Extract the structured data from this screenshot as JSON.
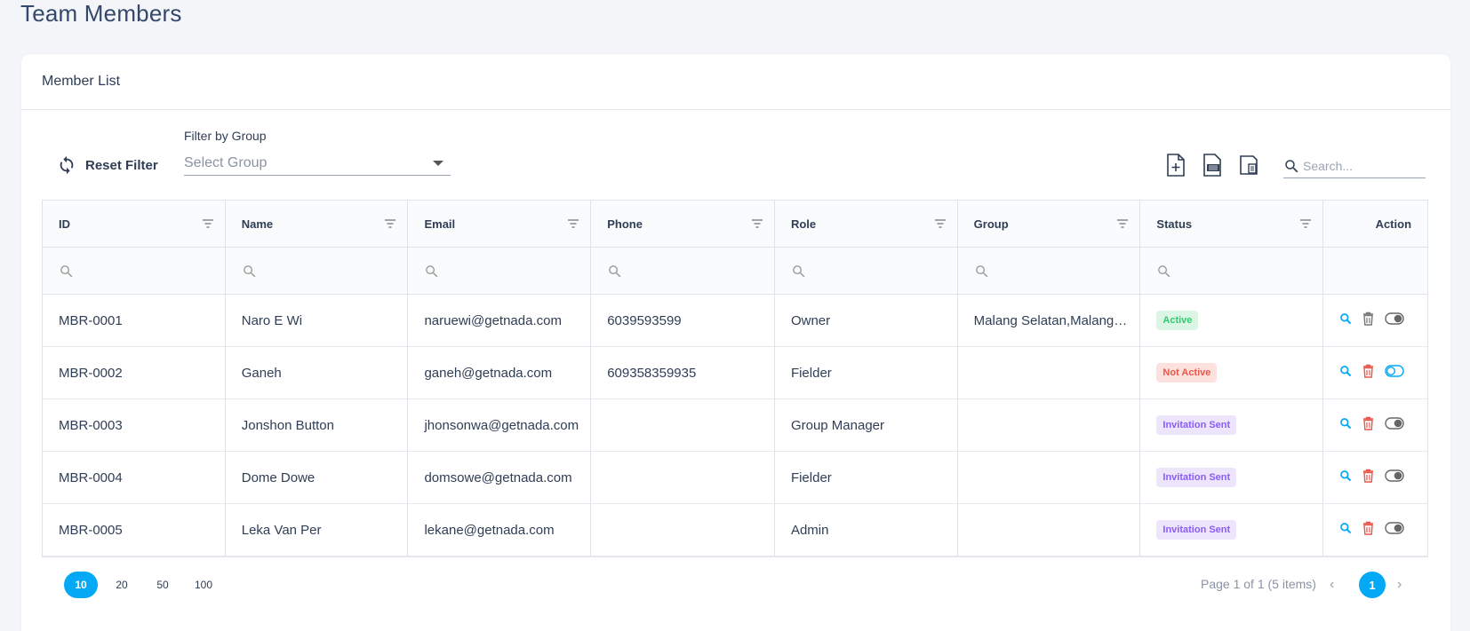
{
  "page": {
    "title": "Team Members"
  },
  "card": {
    "title": "Member List"
  },
  "toolbar": {
    "reset_label": "Reset Filter",
    "filter_label": "Filter by Group",
    "select_placeholder": "Select Group",
    "search_placeholder": "Search..."
  },
  "columns": [
    "ID",
    "Name",
    "Email",
    "Phone",
    "Role",
    "Group",
    "Status",
    "Action"
  ],
  "rows": [
    {
      "id": "MBR-0001",
      "name": "Naro E Wi",
      "email": "naruewi@getnada.com",
      "phone": "6039593599",
      "role": "Owner",
      "group": "Malang Selatan,Malang Utara",
      "status": "Active",
      "status_type": "active",
      "toggle": "off"
    },
    {
      "id": "MBR-0002",
      "name": "Ganeh",
      "email": "ganeh@getnada.com",
      "phone": "609358359935",
      "role": "Fielder",
      "group": "",
      "status": "Not Active",
      "status_type": "inactive",
      "toggle": "outline"
    },
    {
      "id": "MBR-0003",
      "name": "Jonshon Button",
      "email": "jhonsonwa@getnada.com",
      "phone": "",
      "role": "Group Manager",
      "group": "",
      "status": "Invitation Sent",
      "status_type": "invite",
      "toggle": "off"
    },
    {
      "id": "MBR-0004",
      "name": "Dome Dowe",
      "email": "domsowe@getnada.com",
      "phone": "",
      "role": "Fielder",
      "group": "",
      "status": "Invitation Sent",
      "status_type": "invite",
      "toggle": "off"
    },
    {
      "id": "MBR-0005",
      "name": "Leka Van Per",
      "email": "lekane@getnada.com",
      "phone": "",
      "role": "Admin",
      "group": "",
      "status": "Invitation Sent",
      "status_type": "invite",
      "toggle": "off"
    }
  ],
  "pager": {
    "sizes": [
      "10",
      "20",
      "50",
      "100"
    ],
    "active_size": "10",
    "info": "Page 1 of 1 (5 items)",
    "current_page": "1"
  },
  "colors": {
    "accent": "#03a9f4",
    "delete": "#e8574a"
  }
}
